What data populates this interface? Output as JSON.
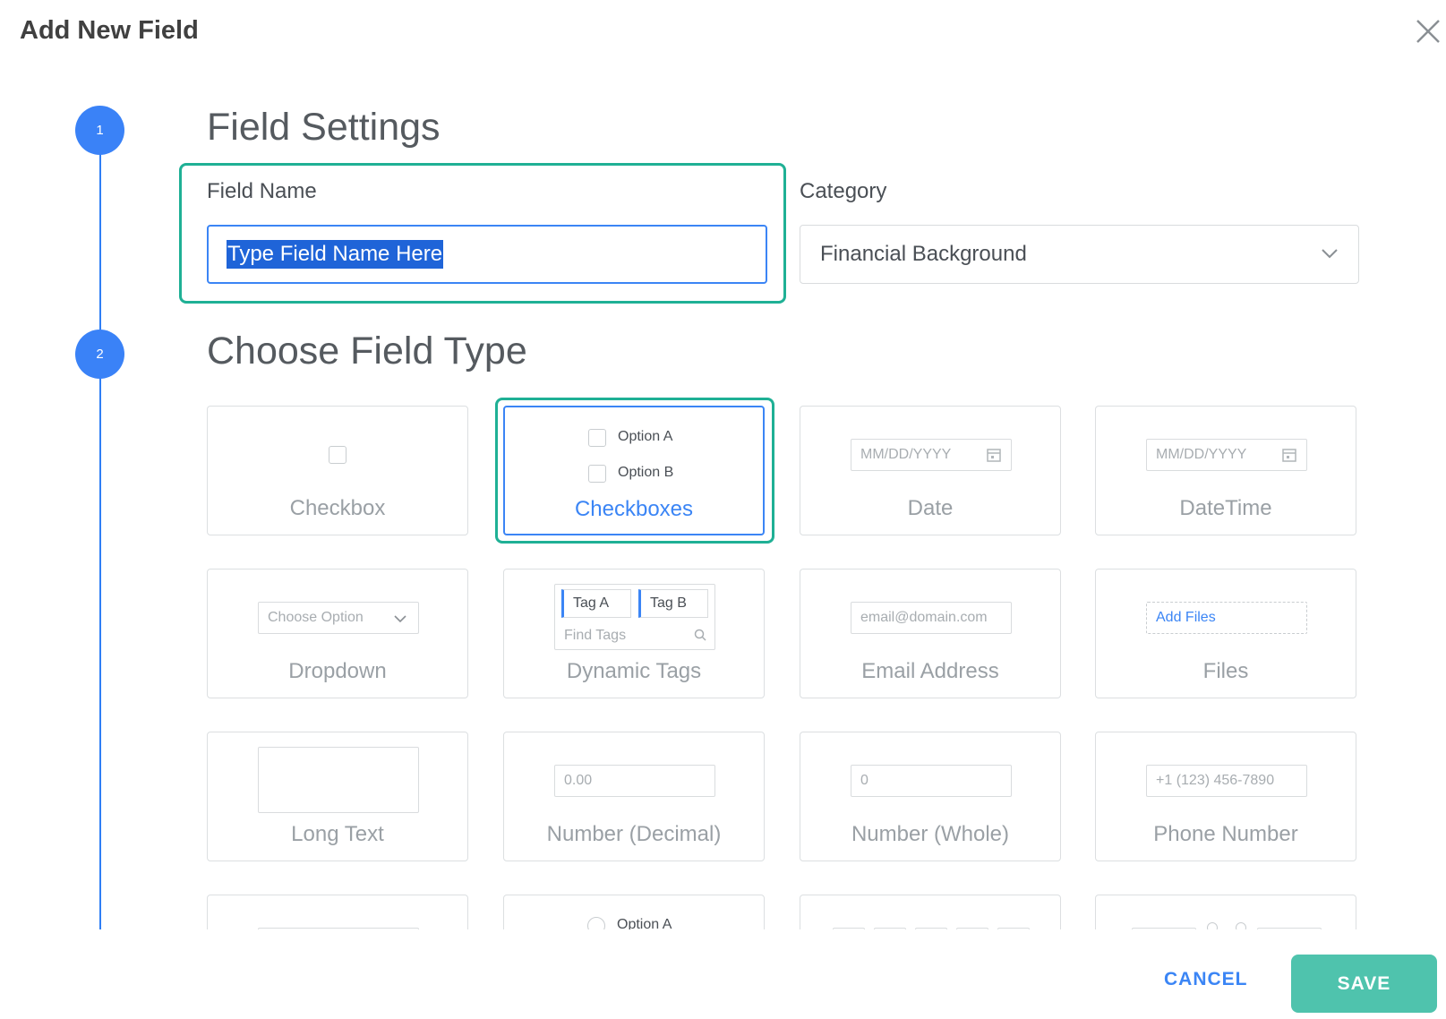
{
  "dialog": {
    "title": "Add New Field",
    "close_icon": "close-icon"
  },
  "steps": [
    {
      "number": "1",
      "title": "Field Settings"
    },
    {
      "number": "2",
      "title": "Choose Field Type"
    }
  ],
  "field_settings": {
    "field_name_label": "Field Name",
    "field_name_value": "Type Field Name Here",
    "category_label": "Category",
    "category_value": "Financial Background"
  },
  "field_types": [
    {
      "label": "Checkbox"
    },
    {
      "label": "Checkboxes",
      "selected": true,
      "options": [
        "Option A",
        "Option B"
      ]
    },
    {
      "label": "Date",
      "placeholder": "MM/DD/YYYY"
    },
    {
      "label": "DateTime",
      "placeholder": "MM/DD/YYYY"
    },
    {
      "label": "Dropdown",
      "placeholder": "Choose Option"
    },
    {
      "label": "Dynamic Tags",
      "tags": [
        "Tag A",
        "Tag B"
      ],
      "placeholder": "Find Tags"
    },
    {
      "label": "Email Address",
      "placeholder": "email@domain.com"
    },
    {
      "label": "Files",
      "placeholder": "Add Files"
    },
    {
      "label": "Long Text"
    },
    {
      "label": "Number (Decimal)",
      "placeholder": "0.00"
    },
    {
      "label": "Number (Whole)",
      "placeholder": "0"
    },
    {
      "label": "Phone Number",
      "placeholder": "+1 (123) 456-7890"
    },
    {
      "label": ""
    },
    {
      "label": "",
      "options": [
        "Option A"
      ]
    },
    {
      "label": ""
    },
    {
      "label": ""
    }
  ],
  "footer": {
    "cancel_label": "CANCEL",
    "save_label": "SAVE"
  },
  "colors": {
    "accent": "#3b85f5",
    "highlight": "#1fb095",
    "save": "#4fc3ad"
  }
}
